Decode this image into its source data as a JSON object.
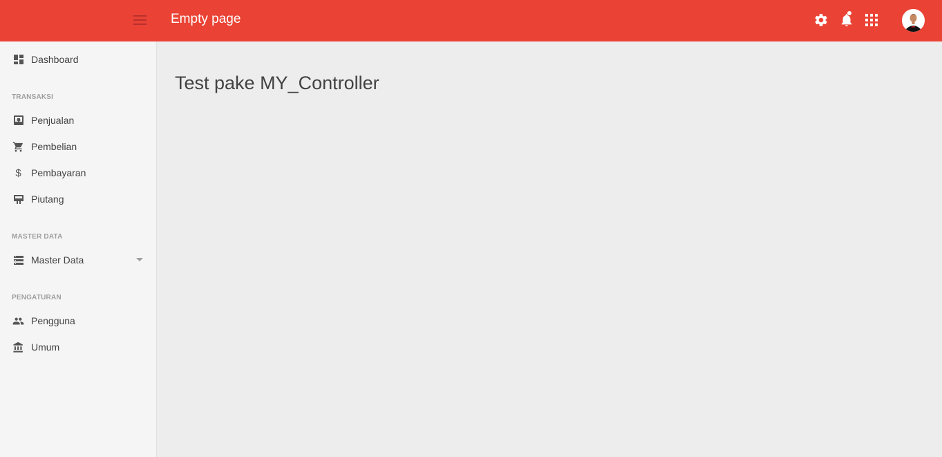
{
  "header": {
    "title": "Empty page",
    "accent_color": "#ea4335",
    "icons": [
      "menu-icon",
      "settings-icon",
      "notifications-icon",
      "apps-icon",
      "avatar"
    ]
  },
  "sidebar": {
    "dashboard": {
      "label": "Dashboard",
      "icon": "dashboard-icon"
    },
    "sections": [
      {
        "title": "TRANSAKSI",
        "items": [
          {
            "label": "Penjualan",
            "icon": "inbox-download-icon"
          },
          {
            "label": "Pembelian",
            "icon": "cart-icon"
          },
          {
            "label": "Pembayaran",
            "icon": "dollar-icon"
          },
          {
            "label": "Piutang",
            "icon": "monitor-icon"
          }
        ]
      },
      {
        "title": "MASTER DATA",
        "items": [
          {
            "label": "Master Data",
            "icon": "storage-icon",
            "has_submenu": true
          }
        ]
      },
      {
        "title": "PENGATURAN",
        "items": [
          {
            "label": "Pengguna",
            "icon": "people-icon"
          },
          {
            "label": "Umum",
            "icon": "bank-icon"
          }
        ]
      }
    ]
  },
  "main": {
    "heading": "Test pake MY_Controller"
  }
}
